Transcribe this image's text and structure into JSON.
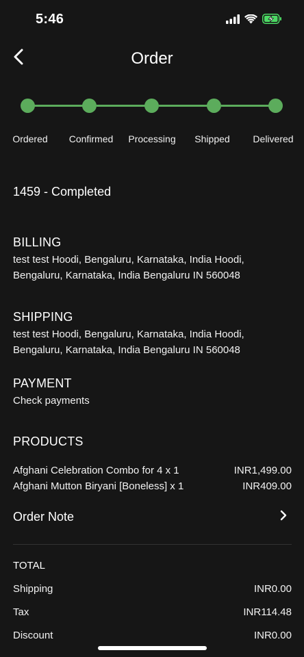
{
  "status_bar": {
    "time": "5:46",
    "icons": [
      "cellular-signal-icon",
      "wifi-icon",
      "battery-charging-icon"
    ],
    "battery_color": "#4cd964"
  },
  "nav": {
    "title": "Order",
    "back_icon": "chevron-left-icon"
  },
  "stepper": {
    "accent_color": "#5cac5c",
    "steps": [
      {
        "label": "Ordered"
      },
      {
        "label": "Confirmed"
      },
      {
        "label": "Processing"
      },
      {
        "label": "Shipped"
      },
      {
        "label": "Delivered"
      }
    ]
  },
  "order": {
    "status_line": "1459 - Completed"
  },
  "billing": {
    "heading": "BILLING",
    "address_line1": "test test Hoodi, Bengaluru, Karnataka, India Hoodi,",
    "address_line2": "Bengaluru, Karnataka, India Bengaluru IN 560048"
  },
  "shipping": {
    "heading": "SHIPPING",
    "address_line1": "test test Hoodi, Bengaluru, Karnataka, India Hoodi,",
    "address_line2": "Bengaluru, Karnataka, India Bengaluru IN 560048"
  },
  "payment": {
    "heading": "PAYMENT",
    "method": "Check payments"
  },
  "products": {
    "heading": "PRODUCTS",
    "items": [
      {
        "name": "Afghani Celebration Combo for 4 x 1",
        "price": "INR1,499.00"
      },
      {
        "name": "Afghani Mutton Biryani [Boneless] x 1",
        "price": "INR409.00"
      }
    ]
  },
  "order_note": {
    "label": "Order Note",
    "icon": "chevron-right-icon"
  },
  "totals": {
    "heading": "TOTAL",
    "rows": [
      {
        "label": "Shipping",
        "value": "INR0.00"
      },
      {
        "label": "Tax",
        "value": "INR114.48"
      },
      {
        "label": "Discount",
        "value": "INR0.00"
      }
    ]
  }
}
